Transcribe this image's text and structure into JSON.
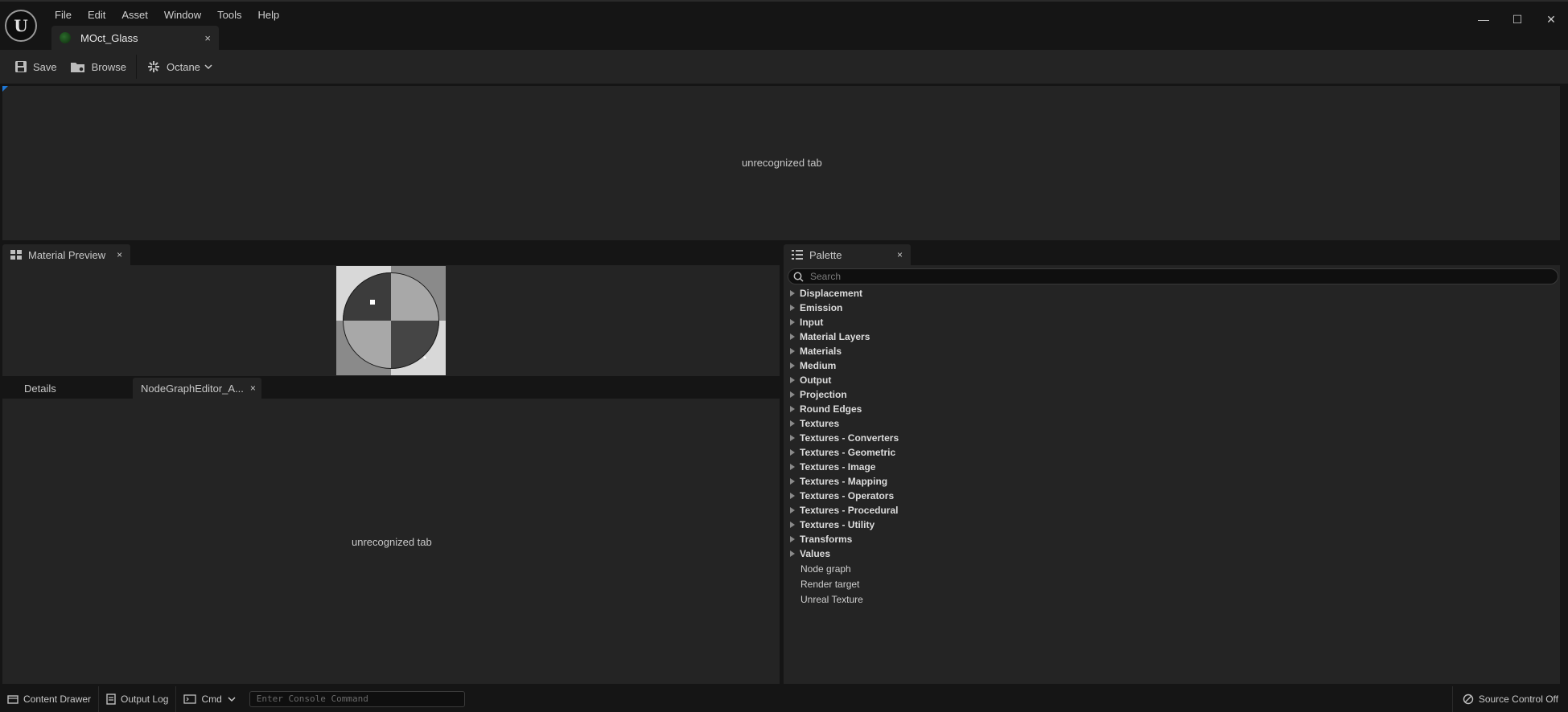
{
  "app": {
    "logo_text": "U"
  },
  "menu": [
    "File",
    "Edit",
    "Asset",
    "Window",
    "Tools",
    "Help"
  ],
  "window_controls": {
    "minimize": "—",
    "maximize": "☐",
    "close": "✕"
  },
  "document_tab": {
    "title": "MOct_Glass",
    "close": "×"
  },
  "toolbar": {
    "save_label": "Save",
    "browse_label": "Browse",
    "octane_label": "Octane"
  },
  "top_panel": {
    "text": "unrecognized tab"
  },
  "material_preview": {
    "tab_label": "Material Preview",
    "close": "×"
  },
  "details_tabs": {
    "details_label": "Details",
    "nodegraph_label": "NodeGraphEditor_A...",
    "close": "×"
  },
  "lower_panel": {
    "text": "unrecognized tab"
  },
  "palette": {
    "tab_label": "Palette",
    "close": "×",
    "search_placeholder": "Search",
    "categories": [
      "Displacement",
      "Emission",
      "Input",
      "Material Layers",
      "Materials",
      "Medium",
      "Output",
      "Projection",
      "Round Edges",
      "Textures",
      "Textures - Converters",
      "Textures - Geometric",
      "Textures - Image",
      "Textures - Mapping",
      "Textures - Operators",
      "Textures - Procedural",
      "Textures - Utility",
      "Transforms",
      "Values"
    ],
    "leaves": [
      "Node graph",
      "Render target",
      "Unreal Texture"
    ]
  },
  "statusbar": {
    "content_drawer": "Content Drawer",
    "output_log": "Output Log",
    "cmd": "Cmd",
    "console_placeholder": "Enter Console Command",
    "source_control": "Source Control Off"
  }
}
